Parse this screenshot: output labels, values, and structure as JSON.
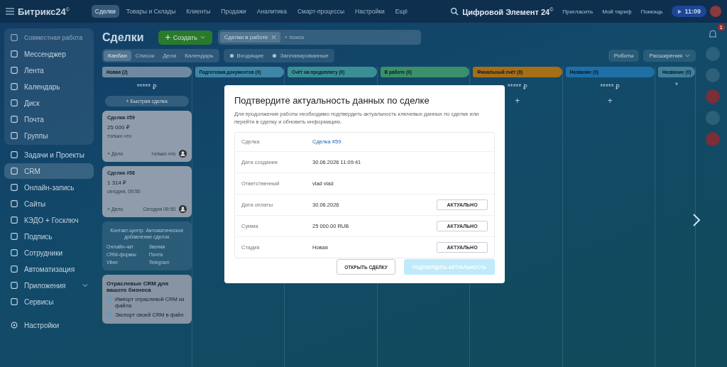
{
  "header": {
    "logo": "Битрикс24",
    "logo_mark": "©",
    "nav": [
      {
        "label": "Сделки",
        "selected": true
      },
      {
        "label": "Товары и Склады",
        "selected": false
      },
      {
        "label": "Клиенты",
        "selected": false
      },
      {
        "label": "Продажи",
        "selected": false
      },
      {
        "label": "Аналитика",
        "selected": false
      },
      {
        "label": "Смарт-процессы",
        "selected": false
      },
      {
        "label": "Настройки",
        "selected": false
      },
      {
        "label": "Ещё",
        "selected": false
      }
    ],
    "company": "Цифровой Элемент 24",
    "company_mark": "©",
    "links": [
      "Пригласить",
      "Мой тариф",
      "Помощь"
    ],
    "time": "11:09"
  },
  "sidebar": {
    "items": [
      {
        "label": "Совместная работа",
        "selected": false,
        "kind": "group"
      },
      {
        "label": "Мессенджер",
        "selected": false
      },
      {
        "label": "Лента",
        "selected": false
      },
      {
        "label": "Календарь",
        "selected": false
      },
      {
        "label": "Диск",
        "selected": false
      },
      {
        "label": "Почта",
        "selected": false
      },
      {
        "label": "Группы",
        "selected": false
      },
      {
        "label": "Задачи и Проекты",
        "selected": false
      },
      {
        "label": "CRM",
        "selected": true
      },
      {
        "label": "Онлайн-запись",
        "selected": false
      },
      {
        "label": "Сайты",
        "selected": false
      },
      {
        "label": "КЭДО + Госключ",
        "selected": false
      },
      {
        "label": "Подпись",
        "selected": false
      },
      {
        "label": "Сотрудники",
        "selected": false
      },
      {
        "label": "Автоматизация",
        "selected": false
      },
      {
        "label": "Приложения",
        "selected": false,
        "kind": "expandable"
      },
      {
        "label": "Сервисы",
        "selected": false
      },
      {
        "label": "Настройки",
        "selected": false,
        "kind": "settings"
      }
    ]
  },
  "toolbar": {
    "title": "Сделки",
    "create": "Создать",
    "filter": "Сделки в работе",
    "search_placeholder": "+ поиск",
    "views": [
      {
        "label": "Канбан",
        "selected": true
      },
      {
        "label": "Список",
        "selected": false
      },
      {
        "label": "Дела",
        "selected": false
      },
      {
        "label": "Календарь",
        "selected": false
      }
    ],
    "counters": [
      "Входящие",
      "Запланированные"
    ],
    "robots": "Роботы",
    "extensions": "Расширения"
  },
  "columns": [
    {
      "name": "Новая",
      "count": "(2)",
      "color": "#6f8aa0",
      "sum": "***** ₽",
      "quick_deal": "+ Быстрая сделка"
    },
    {
      "name": "Подготовка документов",
      "count": "(0)",
      "color": "#3f86a6"
    },
    {
      "name": "Счёт на предоплату",
      "count": "(0)",
      "color": "#3b8f94"
    },
    {
      "name": "В работе",
      "count": "(0)",
      "color": "#3b8f6a"
    },
    {
      "name": "Финальный счёт",
      "count": "(0)",
      "color": "#a66e17",
      "sum": "***** ₽",
      "add": "+"
    },
    {
      "name": "Название",
      "count": "(0)",
      "color": "#1f6fa6",
      "sum": "***** ₽",
      "add": "+"
    },
    {
      "name": "Название",
      "count": "(0)",
      "color": "#3f7f9a",
      "sum": "*"
    }
  ],
  "cards": [
    {
      "title": "Сделка #59",
      "amount": "25 000 ₽",
      "date": "только что",
      "task": "+ Дело",
      "activity": "только что"
    },
    {
      "title": "Сделка #58",
      "amount": "1 314 ₽",
      "date": "сегодня, 09:50",
      "task": "+ Дело",
      "activity": "Сегодня 09:50"
    }
  ],
  "contact_center": {
    "title": "Контакт-центр: Автоматическое добавление сделок",
    "channels": [
      "Онлайн-чат",
      "Звонки",
      "CRM-формы",
      "Почта",
      "Viber",
      "Telegram"
    ]
  },
  "industry": {
    "title": "Отраслевые CRM для вашего бизнеса",
    "links": [
      "Импорт отраслевой CRM из файла",
      "Экспорт своей CRM в файл"
    ]
  },
  "notifications": {
    "badge": "1"
  },
  "modal": {
    "title": "Подтвердите актуальность данных по сделке",
    "text": "Для продолжения работы необходимо подтвердить актуальность ключевых данных по сделке или перейти в сделку и обновить информацию.",
    "rows": [
      {
        "label": "Сделка",
        "value": "Сделка #59",
        "kind": "link"
      },
      {
        "label": "Дата создания",
        "value": "30.06.2026 11:09:41",
        "kind": "text"
      },
      {
        "label": "Ответственный",
        "value": "vlad vlad",
        "kind": "text"
      },
      {
        "label": "Дата оплаты",
        "value": "30.06.2026",
        "kind": "text",
        "button": "АКТУАЛЬНО"
      },
      {
        "label": "Сумма",
        "value": "25 000.00 RUB",
        "kind": "text",
        "button": "АКТУАЛЬНО"
      },
      {
        "label": "Стадия",
        "value": "Новая",
        "kind": "text",
        "button": "АКТУАЛЬНО"
      }
    ],
    "open_button": "ОТКРЫТЬ СДЕЛКУ",
    "confirm_button": {
      "label": "ПОДТВЕРДИТЬ АКТУАЛЬНОСТЬ",
      "disabled": true
    }
  }
}
